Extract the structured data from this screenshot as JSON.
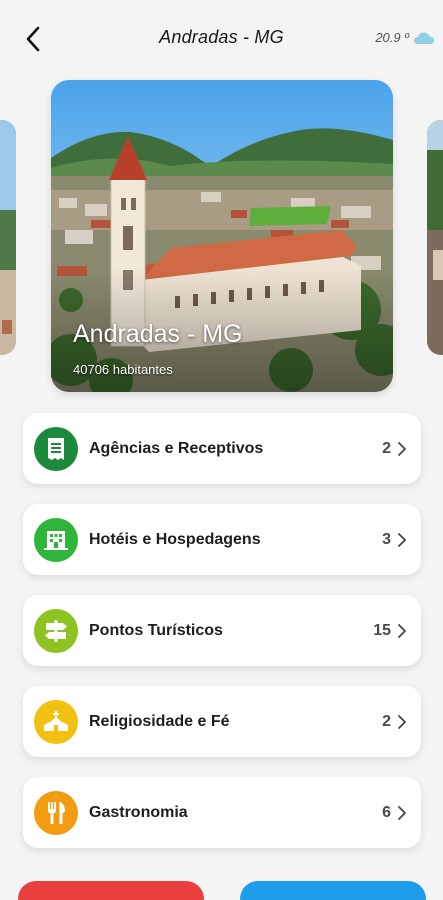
{
  "header": {
    "title": "Andradas - MG",
    "temperature": "20.9 º",
    "back_icon": "chevron-left-icon",
    "weather_icon": "cloud-icon"
  },
  "city": {
    "name": "Andradas - MG",
    "population": "40706 habitantes"
  },
  "categories": [
    {
      "label": "Agências e Receptivos",
      "count": "2",
      "icon": "receipt-icon",
      "color": "#1b8a3c"
    },
    {
      "label": "Hotéis e Hospedagens",
      "count": "3",
      "icon": "hotel-icon",
      "color": "#2fb53b"
    },
    {
      "label": "Pontos Turísticos",
      "count": "15",
      "icon": "signpost-icon",
      "color": "#8cc320"
    },
    {
      "label": "Religiosidade e Fé",
      "count": "2",
      "icon": "church-icon",
      "color": "#f2c00f"
    },
    {
      "label": "Gastronomia",
      "count": "6",
      "icon": "utensils-icon",
      "color": "#f39c12"
    }
  ],
  "bottom_buttons": [
    {
      "color": "#e8403f"
    },
    {
      "color": "#1e9be9"
    }
  ],
  "colors": {
    "background": "#f4f4f4",
    "card": "#ffffff"
  }
}
